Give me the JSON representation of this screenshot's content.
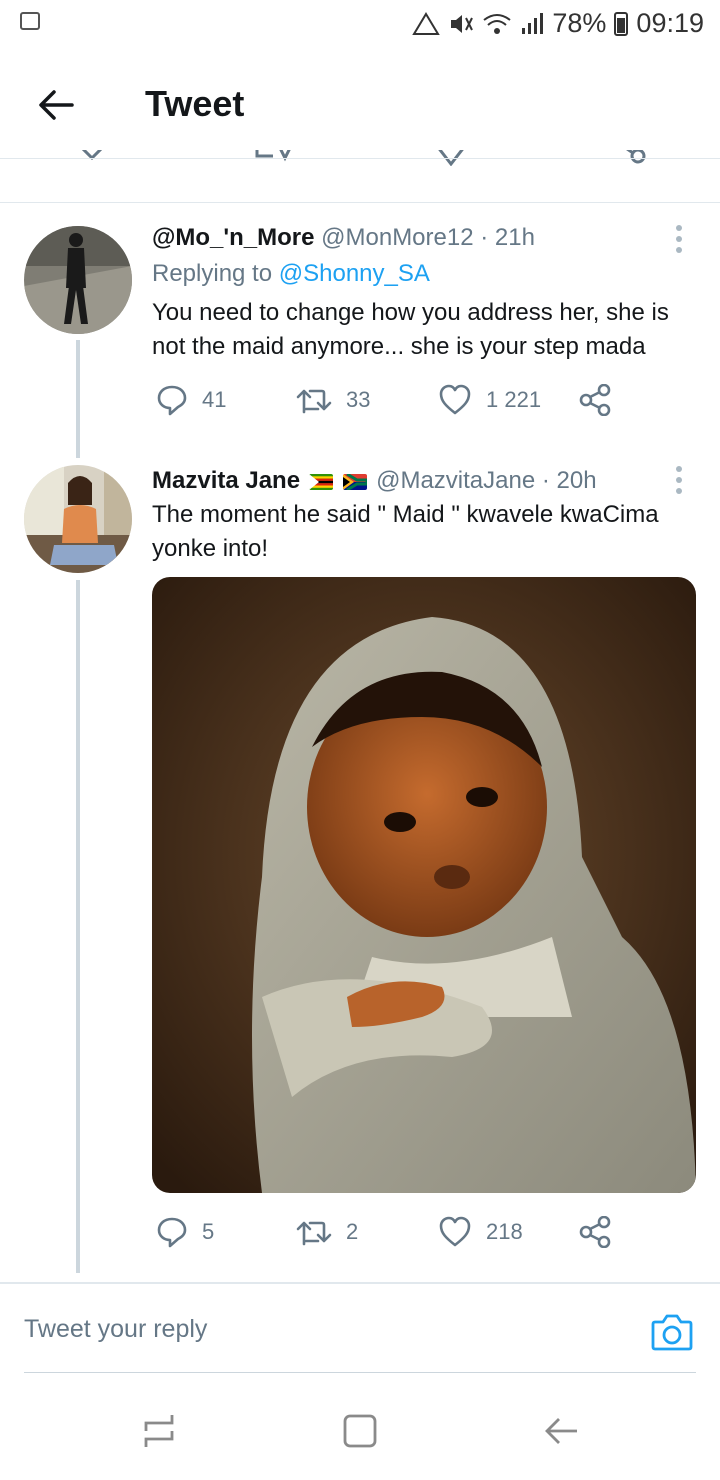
{
  "status_bar": {
    "battery": "78%",
    "time": "09:19"
  },
  "header": {
    "title": "Tweet"
  },
  "tweets": [
    {
      "name": "@Mo_'n_More",
      "handle": "@MonMore12 · 21h",
      "replying_label": "Replying to",
      "replying_to": "@Shonny_SA",
      "text": "You need to change how you address her, she is not the maid anymore... she is your step mada",
      "replies": "41",
      "retweets": "33",
      "likes": "1 221"
    },
    {
      "name": "Mazvita Jane",
      "handle": "@MazvitaJane · 20h",
      "text": "The moment he said \" Maid \" kwavele kwaCima yonke into!",
      "replies": "5",
      "retweets": "2",
      "likes": "218"
    }
  ],
  "reply_bar": {
    "placeholder": "Tweet your reply"
  },
  "colors": {
    "accent": "#1da1f2",
    "muted": "#657786",
    "divider": "#e1e8ed"
  }
}
